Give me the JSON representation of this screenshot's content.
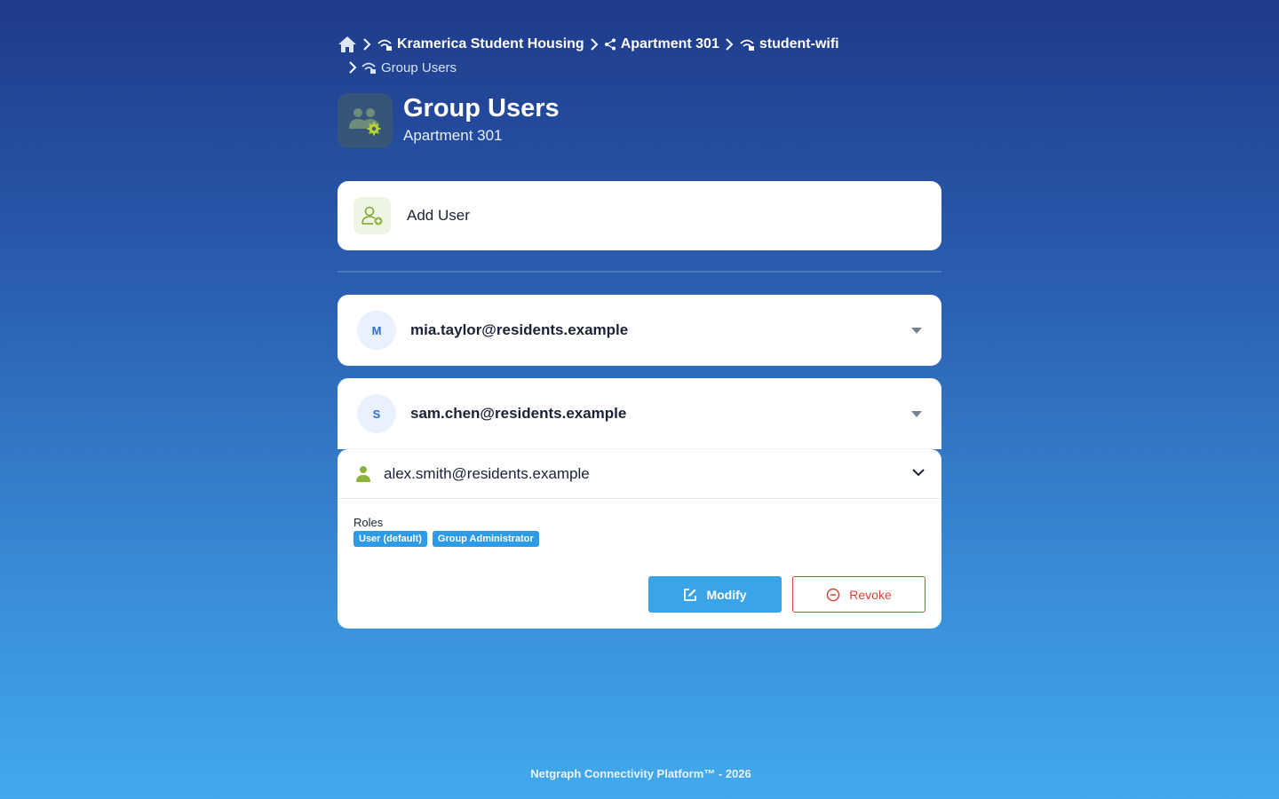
{
  "breadcrumb": {
    "items": [
      {
        "label": "Kramerica Student Housing",
        "icon": "network-icon"
      },
      {
        "label": "Apartment 301",
        "icon": "share-icon"
      },
      {
        "label": "student-wifi",
        "icon": "network-icon"
      },
      {
        "label": "Group Users",
        "icon": "network-icon"
      }
    ]
  },
  "header": {
    "title": "Group Users",
    "subtitle": "Apartment 301",
    "icon": "users-gear-icon"
  },
  "add_user": {
    "label": "Add User",
    "icon": "add-user-icon"
  },
  "users": [
    {
      "avatar": "M",
      "email": "mia.taylor@residents.example",
      "expanded": false
    },
    {
      "avatar": "S",
      "email": "sam.chen@residents.example",
      "expanded": false
    }
  ],
  "selected_user": {
    "email": "alex.smith@residents.example",
    "roles_label": "Roles",
    "roles": [
      "User (default)",
      "Group Administrator"
    ],
    "modify_label": "Modify",
    "revoke_label": "Revoke"
  },
  "footer": {
    "text": "Netgraph Connectivity Platform™ - 2026"
  },
  "colors": {
    "accent": "#3aa4e8",
    "danger": "#d5463a",
    "success": "#8bb43a"
  }
}
